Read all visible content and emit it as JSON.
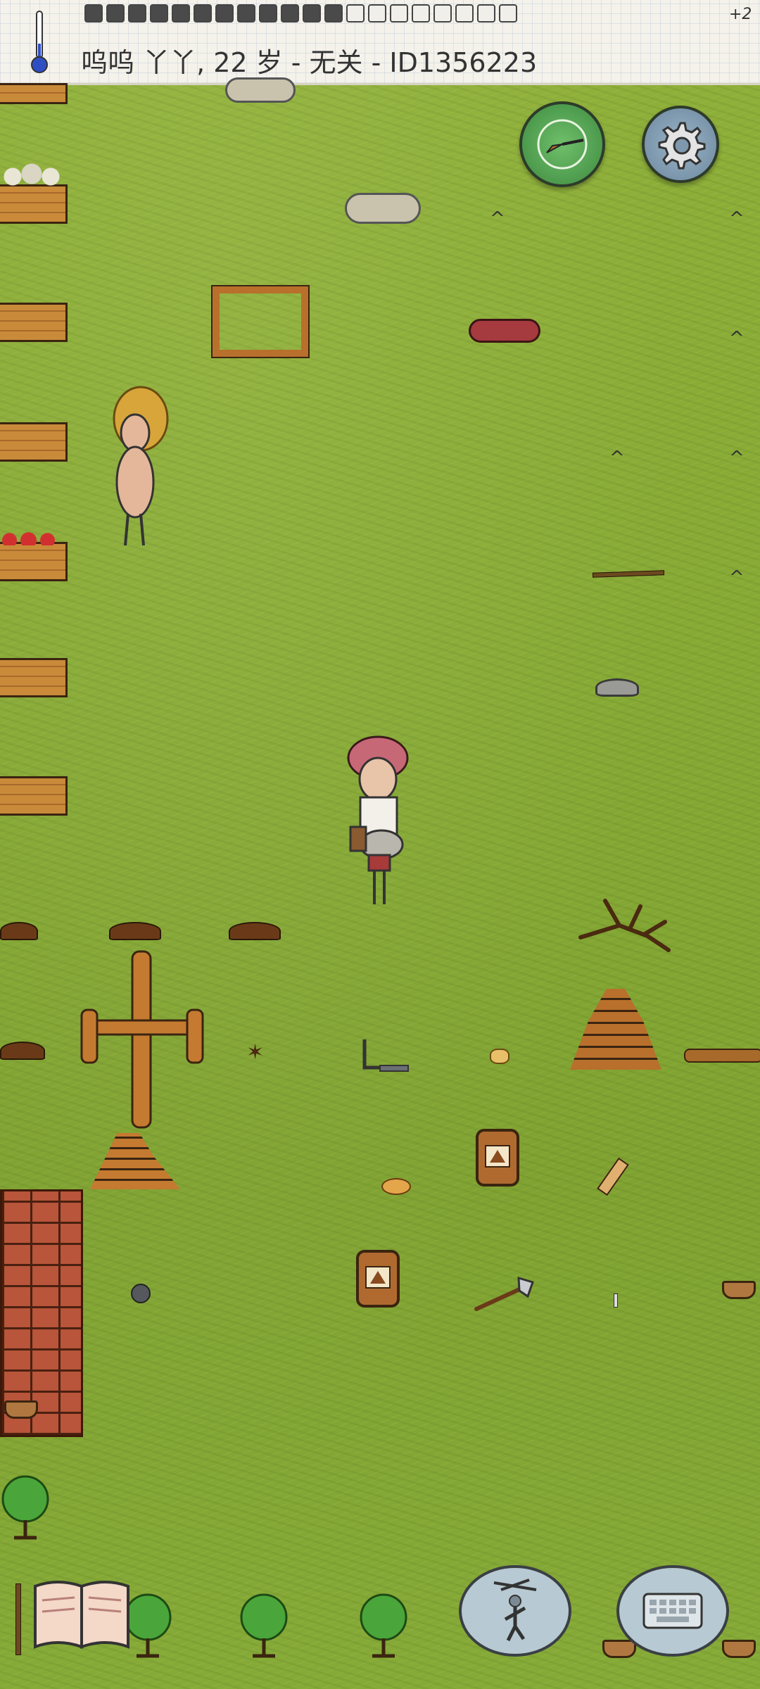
{
  "status_bar": {
    "player_info": "呜呜 丫丫, 22 岁 - 无关 - ID1356223",
    "hunger_bonus": "+2",
    "hunger_full_pips": 12,
    "hunger_total_pips": 20
  },
  "buttons": {
    "compass_icon": "compass-icon",
    "settings_icon": "gear-icon",
    "recipe_book_icon": "book-icon",
    "emote_icon": "puppet-icon",
    "keyboard_icon": "keyboard-icon"
  },
  "colors": {
    "grass": "#86a935",
    "wood": "#c98a3a",
    "brick": "#b8553a",
    "compass_green": "#4e9a4e",
    "settings_blue": "#7e98ad"
  }
}
